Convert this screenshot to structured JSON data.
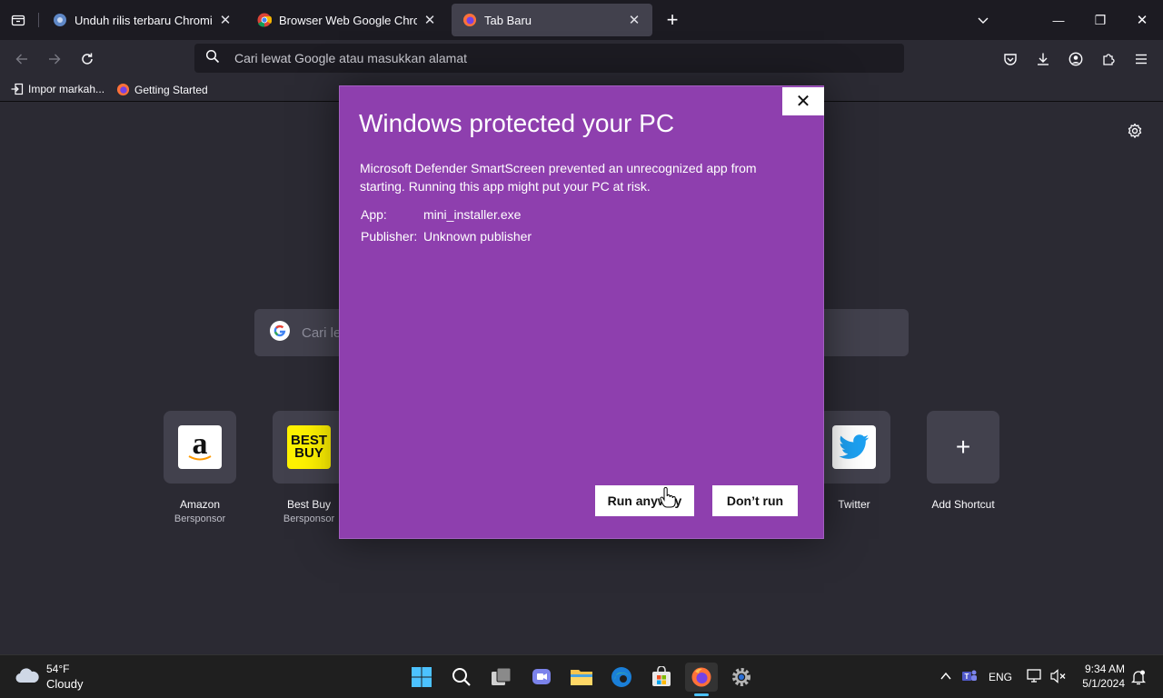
{
  "tabs": [
    {
      "title": "Unduh rilis terbaru Chromium (",
      "close": "✕"
    },
    {
      "title": "Browser Web Google Chrome",
      "close": "✕"
    },
    {
      "title": "Tab Baru",
      "close": "✕"
    }
  ],
  "new_tab_symbol": "+",
  "window_controls": {
    "minimize": "—",
    "restore": "❐",
    "close": "✕"
  },
  "urlbar": {
    "placeholder": "Cari lewat Google atau masukkan alamat"
  },
  "bookmarks": [
    {
      "label": "Impor markah..."
    },
    {
      "label": "Getting Started"
    }
  ],
  "newtab": {
    "search_placeholder": "Cari le",
    "tiles": [
      {
        "label": "Amazon",
        "sub": "Bersponsor",
        "logo": "a"
      },
      {
        "label": "Best Buy",
        "sub": "Bersponsor",
        "logo": "BEST BUY"
      },
      {
        "label": "Twitter",
        "sub": ""
      },
      {
        "label": "Add Shortcut",
        "sub": "",
        "logo": "+"
      }
    ]
  },
  "dialog": {
    "title": "Windows protected your PC",
    "message": "Microsoft Defender SmartScreen prevented an unrecognized app from starting. Running this app might put your PC at risk.",
    "app_label": "App:",
    "app_value": "mini_installer.exe",
    "publisher_label": "Publisher:",
    "publisher_value": "Unknown publisher",
    "run_button": "Run anyway",
    "dont_run_button": "Don’t run",
    "close": "✕"
  },
  "taskbar": {
    "weather_temp": "54°F",
    "weather_desc": "Cloudy",
    "language": "ENG",
    "time": "9:34 AM",
    "date": "5/1/2024"
  },
  "colors": {
    "dialog_bg": "#8e3fae",
    "browser_bg": "#2b2a33",
    "tabstrip_bg": "#1c1b22"
  }
}
